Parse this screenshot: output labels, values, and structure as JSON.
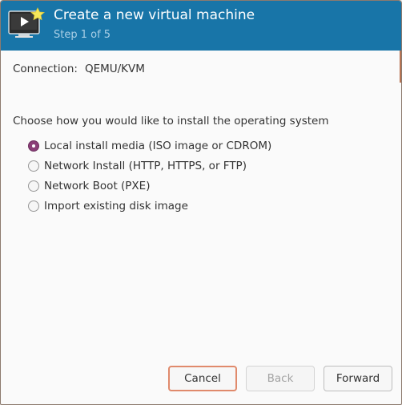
{
  "header": {
    "title": "Create a new virtual machine",
    "subtitle": "Step 1 of 5",
    "icon": "virtual-machine-new-icon"
  },
  "connection": {
    "label": "Connection:",
    "value": "QEMU/KVM"
  },
  "install": {
    "prompt": "Choose how you would like to install the operating system",
    "options": [
      {
        "label": "Local install media (ISO image or CDROM)",
        "checked": true
      },
      {
        "label": "Network Install (HTTP, HTTPS, or FTP)",
        "checked": false
      },
      {
        "label": "Network Boot (PXE)",
        "checked": false
      },
      {
        "label": "Import existing disk image",
        "checked": false
      }
    ]
  },
  "buttons": {
    "cancel": "Cancel",
    "back": "Back",
    "forward": "Forward"
  },
  "colors": {
    "header_bg": "#1875a8",
    "radio_selected": "#8a3e77",
    "focus_border": "#e08a6c"
  }
}
